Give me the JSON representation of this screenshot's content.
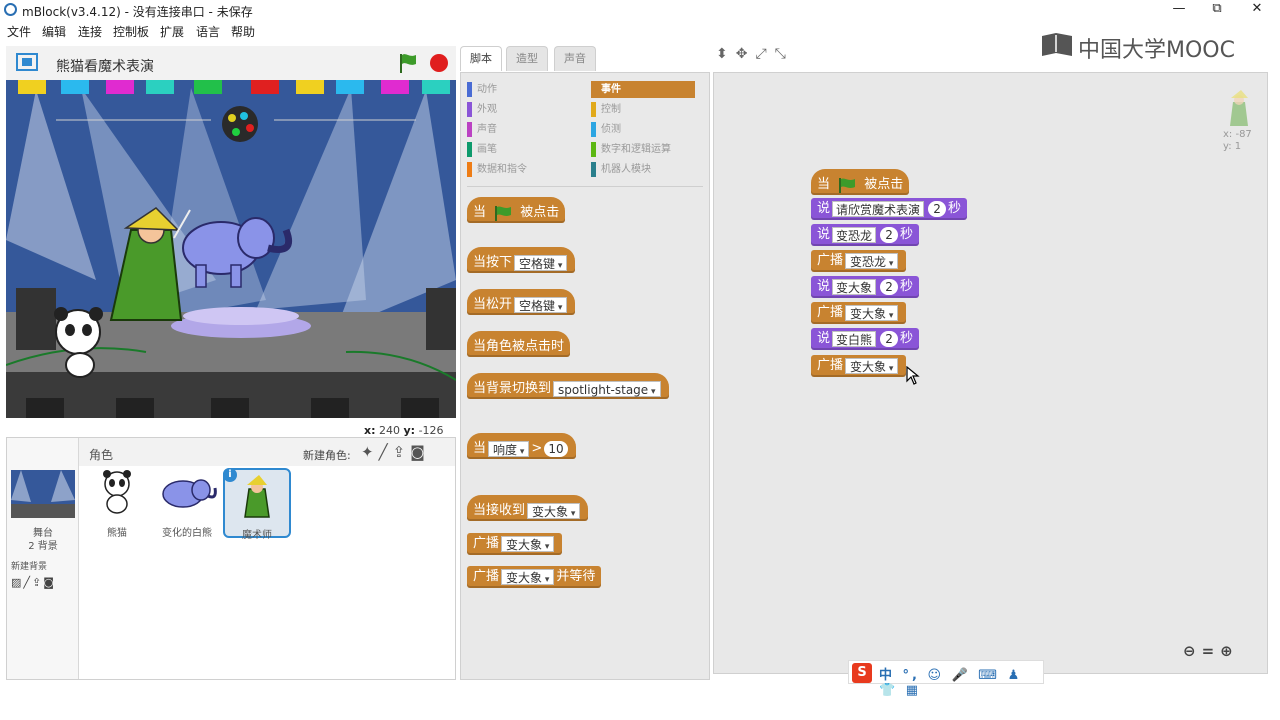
{
  "window": {
    "title": "mBlock(v3.4.12) - 没有连接串口 - 未保存",
    "minimize": "—",
    "restore": "⧉",
    "close": "✕"
  },
  "menu": [
    "文件",
    "编辑",
    "连接",
    "控制板",
    "扩展",
    "语言",
    "帮助"
  ],
  "stage": {
    "project_name": "熊猫看魔术表演",
    "coords_x_label": "x:",
    "coords_x": "240",
    "coords_y_label": "y:",
    "coords_y": "-126"
  },
  "sprites": {
    "header_label": "角色",
    "new_sprite_label": "新建角色:",
    "stage_label": "舞台",
    "backdrop_count": "2 背景",
    "new_backdrop_label": "新建背景",
    "items": [
      {
        "name": "熊猫",
        "selected": false
      },
      {
        "name": "变化的白熊",
        "selected": false
      },
      {
        "name": "魔术师",
        "selected": true
      }
    ],
    "info_badge": "i"
  },
  "tabs": [
    {
      "label": "脚本",
      "active": true
    },
    {
      "label": "造型",
      "active": false
    },
    {
      "label": "声音",
      "active": false
    }
  ],
  "categories": [
    {
      "label": "动作",
      "color": "#4a6cd4"
    },
    {
      "label": "事件",
      "color": "#c88330",
      "active": true
    },
    {
      "label": "外观",
      "color": "#8a55d7"
    },
    {
      "label": "控制",
      "color": "#e1a91a"
    },
    {
      "label": "声音",
      "color": "#bb42c3"
    },
    {
      "label": "侦测",
      "color": "#2ca5e2"
    },
    {
      "label": "画笔",
      "color": "#0e9a6c"
    },
    {
      "label": "数字和逻辑运算",
      "color": "#5cb712"
    },
    {
      "label": "数据和指令",
      "color": "#ee7d16"
    },
    {
      "label": "机器人模块",
      "color": "#2a7f8c"
    }
  ],
  "palette_blocks": {
    "when_flag": {
      "pre": "当",
      "post": "被点击"
    },
    "when_key_pressed": {
      "pre": "当按下",
      "key": "空格键"
    },
    "when_key_released": {
      "pre": "当松开",
      "key": "空格键"
    },
    "when_sprite_clicked": {
      "pre": "当角色被点击时"
    },
    "when_backdrop": {
      "pre": "当背景切换到",
      "backdrop": "spotlight-stage"
    },
    "when_loudness": {
      "pre": "当",
      "sensor": "响度",
      "op": ">",
      "value": "10"
    },
    "when_receive": {
      "pre": "当接收到",
      "message": "变大象"
    },
    "broadcast": {
      "pre": "广播",
      "message": "变大象"
    },
    "broadcast_wait": {
      "pre": "广播",
      "message": "变大象",
      "post": "并等待"
    }
  },
  "script": {
    "hat": {
      "pre": "当",
      "post": "被点击"
    },
    "blocks": [
      {
        "type": "say",
        "verb": "说",
        "text": "请欣赏魔术表演",
        "secs": "2",
        "unit": "秒"
      },
      {
        "type": "say",
        "verb": "说",
        "text": "变恐龙",
        "secs": "2",
        "unit": "秒"
      },
      {
        "type": "broadcast",
        "verb": "广播",
        "message": "变恐龙"
      },
      {
        "type": "say",
        "verb": "说",
        "text": "变大象",
        "secs": "2",
        "unit": "秒"
      },
      {
        "type": "broadcast",
        "verb": "广播",
        "message": "变大象"
      },
      {
        "type": "say",
        "verb": "说",
        "text": "变白熊",
        "secs": "2",
        "unit": "秒"
      },
      {
        "type": "broadcast",
        "verb": "广播",
        "message": "变大象"
      }
    ]
  },
  "sprite_corner": {
    "x": "x: -87",
    "y": "y: 1"
  },
  "toolbar_icons": "⬍✥⤢⤡",
  "zoom": "🔍=🔍",
  "watermark": {
    "text": "中国大学MOOC"
  },
  "ime": {
    "logo": "S",
    "rest": "中 °, ☺ 🎤 ⌨ ♟ 👕 ▦"
  },
  "colors": {
    "events": "#c88330",
    "looks": "#8a55d7",
    "accent": "#2f89d0",
    "stop": "#e01e1e"
  }
}
